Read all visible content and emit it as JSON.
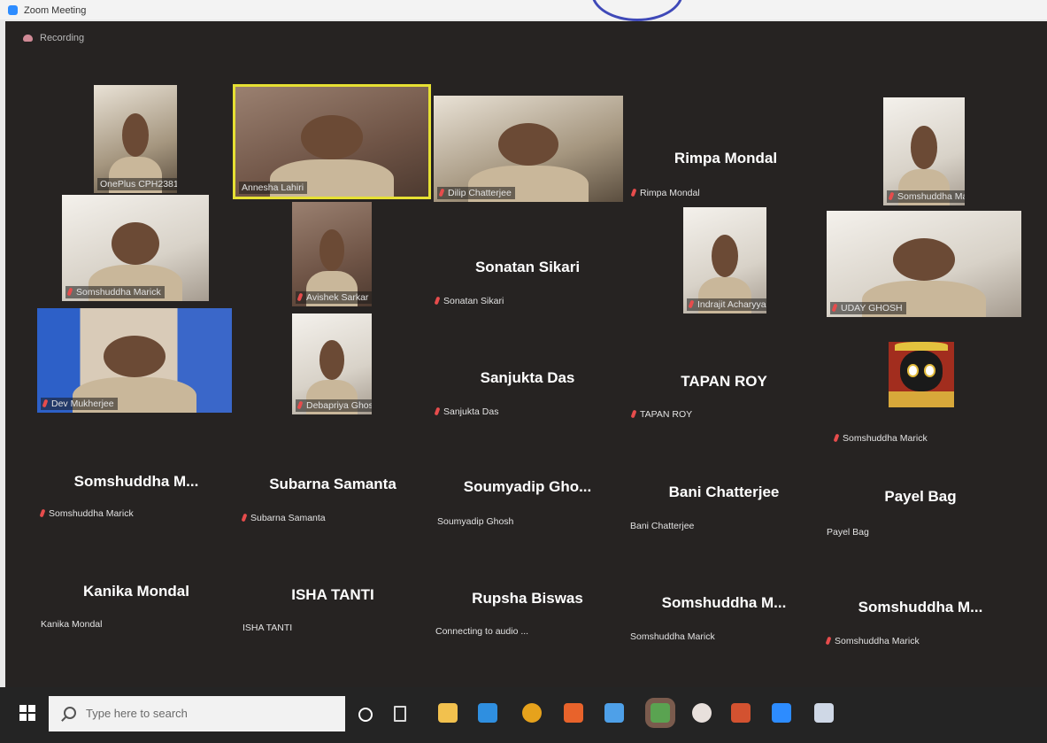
{
  "window": {
    "title": "Zoom Meeting"
  },
  "meeting": {
    "recording_label": "Recording",
    "participants": [
      {
        "display_name": "",
        "nameplate": "OnePlus CPH2381",
        "video": true,
        "muted": false,
        "speaking": false
      },
      {
        "display_name": "",
        "nameplate": "Annesha Lahiri",
        "video": true,
        "muted": false,
        "speaking": true
      },
      {
        "display_name": "",
        "nameplate": "Dilip Chatterjee",
        "video": true,
        "muted": true,
        "speaking": false
      },
      {
        "display_name": "Rimpa Mondal",
        "nameplate": "Rimpa Mondal",
        "video": false,
        "muted": true,
        "speaking": false
      },
      {
        "display_name": "",
        "nameplate": "Somshuddha Marick",
        "video": true,
        "muted": true,
        "speaking": false
      },
      {
        "display_name": "",
        "nameplate": "Somshuddha Marick",
        "video": true,
        "muted": true,
        "speaking": false
      },
      {
        "display_name": "",
        "nameplate": "Avishek Sarkar",
        "video": true,
        "muted": true,
        "speaking": false
      },
      {
        "display_name": "Sonatan Sikari",
        "nameplate": "Sonatan Sikari",
        "video": false,
        "muted": true,
        "speaking": false
      },
      {
        "display_name": "",
        "nameplate": "Indrajit Acharyya",
        "video": true,
        "muted": true,
        "speaking": false
      },
      {
        "display_name": "",
        "nameplate": "UDAY GHOSH",
        "video": true,
        "muted": true,
        "speaking": false
      },
      {
        "display_name": "",
        "nameplate": "Dev Mukherjee",
        "video": true,
        "muted": true,
        "speaking": false
      },
      {
        "display_name": "",
        "nameplate": "Debapriya Ghosh",
        "video": true,
        "muted": true,
        "speaking": false
      },
      {
        "display_name": "Sanjukta Das",
        "nameplate": "Sanjukta Das",
        "video": false,
        "muted": true,
        "speaking": false
      },
      {
        "display_name": "TAPAN ROY",
        "nameplate": "TAPAN ROY",
        "video": false,
        "muted": true,
        "speaking": false
      },
      {
        "display_name": "",
        "nameplate": "Somshuddha Marick",
        "video": true,
        "muted": true,
        "speaking": false
      },
      {
        "display_name": "Somshuddha M...",
        "nameplate": "Somshuddha Marick",
        "video": false,
        "muted": true,
        "speaking": false
      },
      {
        "display_name": "Subarna Samanta",
        "nameplate": "Subarna Samanta",
        "video": false,
        "muted": true,
        "speaking": false
      },
      {
        "display_name": "Soumyadip Gho...",
        "nameplate": "Soumyadip Ghosh",
        "video": false,
        "muted": false,
        "speaking": false
      },
      {
        "display_name": "Bani Chatterjee",
        "nameplate": "Bani Chatterjee",
        "video": false,
        "muted": false,
        "speaking": false
      },
      {
        "display_name": "Payel Bag",
        "nameplate": "Payel Bag",
        "video": false,
        "muted": false,
        "speaking": false
      },
      {
        "display_name": "Kanika Mondal",
        "nameplate": "Kanika Mondal",
        "video": false,
        "muted": false,
        "speaking": false
      },
      {
        "display_name": "ISHA TANTI",
        "nameplate": "ISHA TANTI",
        "video": false,
        "muted": false,
        "speaking": false
      },
      {
        "display_name": "Rupsha Biswas",
        "nameplate": "Connecting to audio ...",
        "video": false,
        "muted": false,
        "speaking": false
      },
      {
        "display_name": "Somshuddha M...",
        "nameplate": "Somshuddha Marick",
        "video": false,
        "muted": false,
        "speaking": false
      },
      {
        "display_name": "Somshuddha M...",
        "nameplate": "Somshuddha Marick",
        "video": false,
        "muted": true,
        "speaking": false
      }
    ]
  },
  "taskbar": {
    "search_placeholder": "Type here to search",
    "apps": [
      {
        "icon": "task-view-circle-icon",
        "color": "#ffffff"
      },
      {
        "icon": "task-view-icon",
        "color": "#d9d9d9"
      },
      {
        "icon": "file-explorer-icon",
        "color": "#f2c14e"
      },
      {
        "icon": "mail-icon",
        "color": "#2f8fe0"
      },
      {
        "icon": "chrome-icon",
        "color": "#e6a21c"
      },
      {
        "icon": "firefox-icon",
        "color": "#e8632b"
      },
      {
        "icon": "checkmark-app-icon",
        "color": "#4ea0e8"
      },
      {
        "icon": "chrome-profile-icon",
        "color": "#5aa351"
      },
      {
        "icon": "chrome-alt-icon",
        "color": "#e8e0dc"
      },
      {
        "icon": "powerpoint-icon",
        "color": "#d35230"
      },
      {
        "icon": "zoom-icon",
        "color": "#2d8cff"
      },
      {
        "icon": "bird-app-icon",
        "color": "#cfd8e6"
      }
    ]
  }
}
